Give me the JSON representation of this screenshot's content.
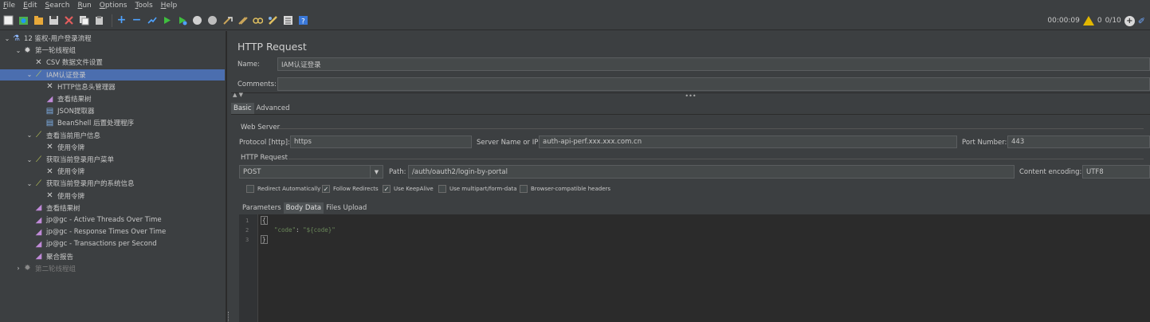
{
  "menu": [
    {
      "mn": "F",
      "rest": "ile"
    },
    {
      "mn": "E",
      "rest": "dit"
    },
    {
      "mn": "S",
      "rest": "earch"
    },
    {
      "mn": "R",
      "rest": "un"
    },
    {
      "mn": "O",
      "rest": "ptions"
    },
    {
      "mn": "T",
      "rest": "ools"
    },
    {
      "mn": "H",
      "rest": "elp"
    }
  ],
  "status": {
    "timer": "00:00:09",
    "warnings": "0",
    "threads": "0/10"
  },
  "tree": [
    {
      "label": "12 鉴权-用户登录流程",
      "arrow": "expanded",
      "icon": "flask-icon",
      "icolor": "#8fb8ff"
    },
    {
      "label": "第一轮线程组",
      "arrow": "expanded",
      "icon": "gear-icon",
      "icolor": "#d0d0d0"
    },
    {
      "label": "CSV 数据文件设置",
      "arrow": "",
      "icon": "scissors-icon",
      "icolor": "#d0d0d0"
    },
    {
      "label": "IAM认证登录",
      "arrow": "expanded",
      "icon": "sampler-icon",
      "icolor": "#c9d55a",
      "selected": true
    },
    {
      "label": "HTTP信息头管理器",
      "arrow": "",
      "icon": "scissors-icon",
      "icolor": "#d0d0d0"
    },
    {
      "label": "查看结果树",
      "arrow": "",
      "icon": "graph-icon",
      "icolor": "#c08ad8"
    },
    {
      "label": "JSON提取器",
      "arrow": "",
      "icon": "doc-icon",
      "icolor": "#7fb0e8"
    },
    {
      "label": "BeanShell 后置处理程序",
      "arrow": "",
      "icon": "doc-icon",
      "icolor": "#7fb0e8"
    },
    {
      "label": "查看当前用户信息",
      "arrow": "expanded",
      "icon": "sampler-icon",
      "icolor": "#c9d55a"
    },
    {
      "label": "使用令牌",
      "arrow": "",
      "icon": "scissors-icon",
      "icolor": "#d0d0d0"
    },
    {
      "label": "获取当前登录用户菜单",
      "arrow": "expanded",
      "icon": "sampler-icon",
      "icolor": "#c9d55a"
    },
    {
      "label": "使用令牌",
      "arrow": "",
      "icon": "scissors-icon",
      "icolor": "#d0d0d0"
    },
    {
      "label": "获取当前登录用户的系统信息",
      "arrow": "expanded",
      "icon": "sampler-icon",
      "icolor": "#c9d55a"
    },
    {
      "label": "使用令牌",
      "arrow": "",
      "icon": "scissors-icon",
      "icolor": "#d0d0d0"
    },
    {
      "label": "查看结果树",
      "arrow": "",
      "icon": "graph-icon",
      "icolor": "#c08ad8"
    },
    {
      "label": "jp@gc - Active Threads Over Time",
      "arrow": "",
      "icon": "graph-icon",
      "icolor": "#c08ad8"
    },
    {
      "label": "jp@gc - Response Times Over Time",
      "arrow": "",
      "icon": "graph-icon",
      "icolor": "#c08ad8"
    },
    {
      "label": "jp@gc - Transactions per Second",
      "arrow": "",
      "icon": "graph-icon",
      "icolor": "#c08ad8"
    },
    {
      "label": "聚合报告",
      "arrow": "",
      "icon": "graph-icon",
      "icolor": "#c08ad8"
    },
    {
      "label": "第二轮线程组",
      "arrow": "collapsed",
      "icon": "gear-icon",
      "icolor": "#8a8a8a",
      "dim": true
    }
  ],
  "panel": {
    "title": "HTTP Request",
    "name_label": "Name:",
    "name_value": "IAM认证登录",
    "comments_label": "Comments:",
    "comments_value": "",
    "split_dots": "•••",
    "split_arrows": "▲ ▼",
    "tabs": [
      "Basic",
      "Advanced"
    ],
    "web_server": {
      "title": "Web Server",
      "protocol_label": "Protocol [http]:",
      "protocol_value": "https",
      "server_label": "Server Name or IP:",
      "server_value": "auth-api-perf.xxx.xxx.com.cn",
      "port_label": "Port Number:",
      "port_value": "443"
    },
    "http_request": {
      "title": "HTTP Request",
      "method": "POST",
      "path_label": "Path:",
      "path_value": "/auth/oauth2/login-by-portal",
      "encoding_label": "Content encoding:",
      "encoding_value": "UTF8"
    },
    "checkboxes": [
      {
        "label": "Redirect Automatically",
        "checked": false
      },
      {
        "label": "Follow Redirects",
        "checked": true
      },
      {
        "label": "Use KeepAlive",
        "checked": true
      },
      {
        "label": "Use multipart/form-data",
        "checked": false
      },
      {
        "label": "Browser-compatible headers",
        "checked": false
      }
    ],
    "sub_tabs": [
      "Parameters",
      "Body Data",
      "Files Upload"
    ],
    "body": {
      "line_numbers": [
        "1",
        "2",
        "3"
      ],
      "open_brace": "{",
      "key": "\"code\"",
      "colon": ": ",
      "value": "\"${code}\"",
      "close_brace": "}"
    }
  }
}
